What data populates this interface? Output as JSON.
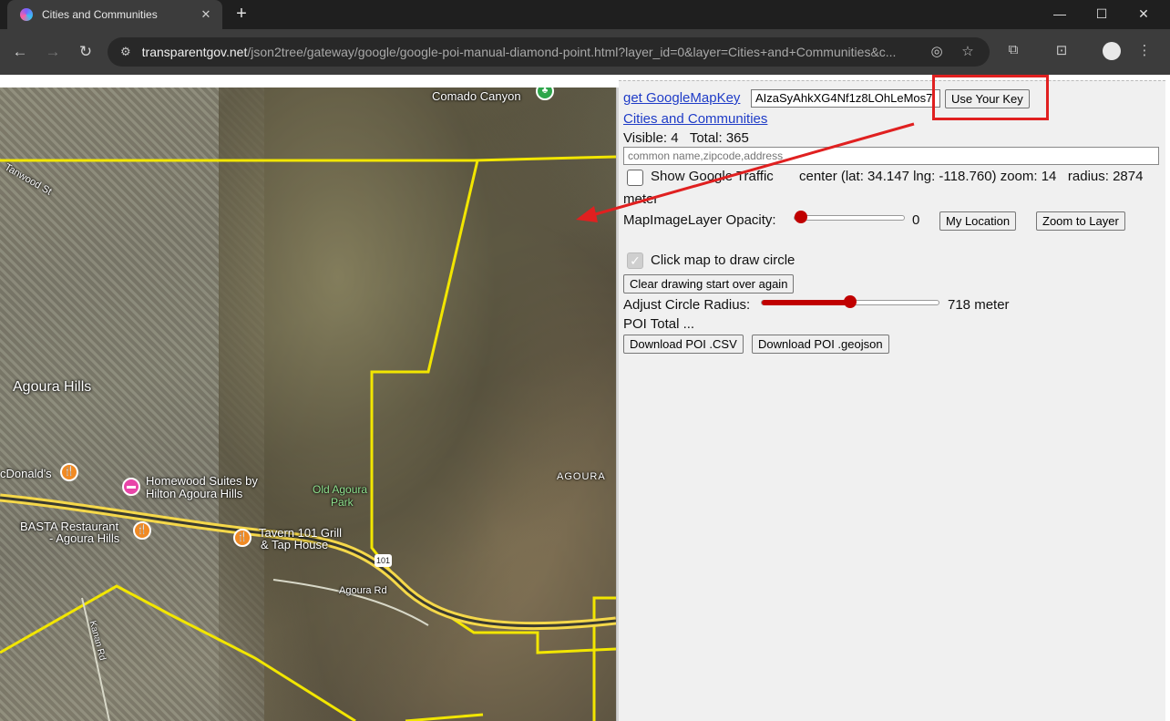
{
  "browser": {
    "tab_title": "Cities and Communities",
    "tab_close": "✕",
    "new_tab": "+",
    "window": {
      "minimize": "—",
      "maximize": "☐",
      "close": "✕"
    },
    "url_host": "transparentgov.net",
    "url_path": "/json2tree/gateway/google/google-poi-manual-diamond-point.html?layer_id=0&layer=Cities+and+Communities&c..."
  },
  "map": {
    "labels": {
      "comado": "Comado Canyon",
      "street": "Tanwood St",
      "agoura_hills": "Agoura Hills",
      "mcdonalds": "cDonald's",
      "homewood1": "Homewood Suites by",
      "homewood2": "Hilton Agoura Hills",
      "park1": "Old Agoura",
      "park2": "Park",
      "basta1": "BASTA Restaurant",
      "basta2": "- Agoura Hills",
      "tavern1": "Tavern 101 Grill",
      "tavern2": "& Tap House",
      "agoura_rd": "Agoura Rd",
      "agoura_area": "AGOURA",
      "kanan": "Kanan Rd",
      "hwy": "101"
    },
    "colors": {
      "boundary": "#f2e600",
      "freeway": "#f5d84a"
    }
  },
  "panel": {
    "get_key_link": "get GoogleMapKey",
    "api_key_value": "AIzaSyAhkXG4Nf1z8LOhLeMos7",
    "use_key_button": "Use Your Key",
    "layer_link": "Cities and Communities",
    "visible_text": "Visible: 4   Total: 365",
    "search_placeholder": "common name,zipcode,address",
    "traffic_label": "Show Google Traffic",
    "center_info": "center (lat: 34.147 lng: -118.760) zoom: 14   radius: 2874",
    "meter_wrap": "meter",
    "opacity_label": "MapImageLayer Opacity:",
    "opacity_value": "0",
    "opacity_level": 0,
    "my_location_button": "My Location",
    "zoom_layer_button": "Zoom to Layer",
    "draw_circle_label": "Click map to draw circle",
    "clear_button": "Clear drawing start over again",
    "radius_label": "Adjust Circle Radius:",
    "radius_value": "718 meter",
    "radius_level": 0.5,
    "poi_total": "POI Total ...",
    "download_csv": "Download POI .CSV",
    "download_geojson": "Download POI .geojson"
  },
  "annotation": {
    "color": "#e02020"
  }
}
